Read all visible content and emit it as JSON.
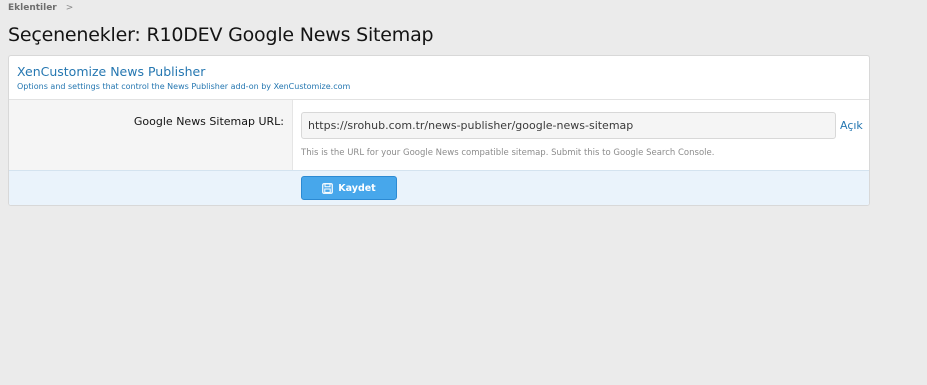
{
  "breadcrumb": {
    "items": [
      "Eklentiler"
    ],
    "separator": ">"
  },
  "page": {
    "title": "Seçenenekler: R10DEV Google News Sitemap"
  },
  "panel": {
    "title": "XenCustomize News Publisher",
    "description": "Options and settings that control the News Publisher add-on by XenCustomize.com"
  },
  "option": {
    "label": "Google News Sitemap URL:",
    "value": "https://srohub.com.tr/news-publisher/google-news-sitemap",
    "open_link": "Açık",
    "hint": "This is the URL for your Google News compatible sitemap. Submit this to Google Search Console."
  },
  "footer": {
    "save_label": "Kaydet",
    "save_icon": "save-icon"
  },
  "colors": {
    "accent": "#2577b1",
    "button": "#47a7eb",
    "footer_bg": "#eaf3fb",
    "page_bg": "#ebebeb"
  }
}
